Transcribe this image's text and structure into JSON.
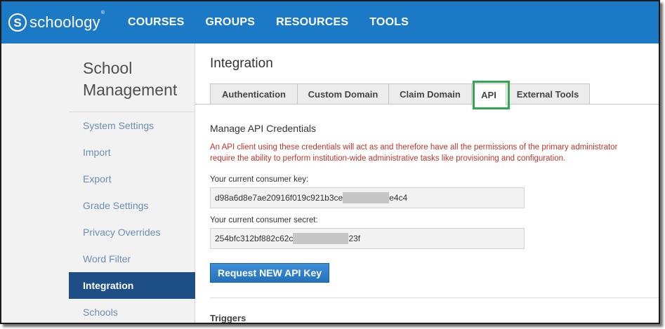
{
  "header": {
    "logo_text": "schoology",
    "logo_mark": "S",
    "logo_tm": "®",
    "nav": [
      "COURSES",
      "GROUPS",
      "RESOURCES",
      "TOOLS"
    ]
  },
  "sidebar": {
    "title": "School Management",
    "items": [
      {
        "label": "System Settings"
      },
      {
        "label": "Import"
      },
      {
        "label": "Export"
      },
      {
        "label": "Grade Settings"
      },
      {
        "label": "Privacy Overrides"
      },
      {
        "label": "Word Filter"
      },
      {
        "label": "Integration",
        "active": true
      },
      {
        "label": "Schools"
      }
    ]
  },
  "main": {
    "title": "Integration",
    "tabs": [
      {
        "label": "Authentication"
      },
      {
        "label": "Custom Domain"
      },
      {
        "label": "Claim Domain"
      },
      {
        "label": "API",
        "active": true
      },
      {
        "label": "External Tools"
      }
    ],
    "section_title": "Manage API Credentials",
    "warning_line1": "An API client using these credentials will act as and therefore have all the permissions of the primary administrator",
    "warning_line2": "require the ability to perform institution-wide administrative tasks like provisioning and configuration.",
    "consumer_key_label": "Your current consumer key:",
    "consumer_key_start": "d98a6d8e7ae20916f019c921b3ce",
    "consumer_key_end": "e4c4",
    "consumer_secret_label": "Your current consumer secret:",
    "consumer_secret_start": "254bfc312bf882c62c",
    "consumer_secret_end": "23f",
    "request_button": "Request NEW API Key",
    "triggers_title": "Triggers"
  },
  "colors": {
    "header_bg": "#1b79c6",
    "sidebar_active_bg": "#1d4f86",
    "sidebar_link": "#6b8fb3",
    "warning_text": "#c4342b",
    "highlight_box": "#2fa84f",
    "button_bg": "#2371b9"
  }
}
